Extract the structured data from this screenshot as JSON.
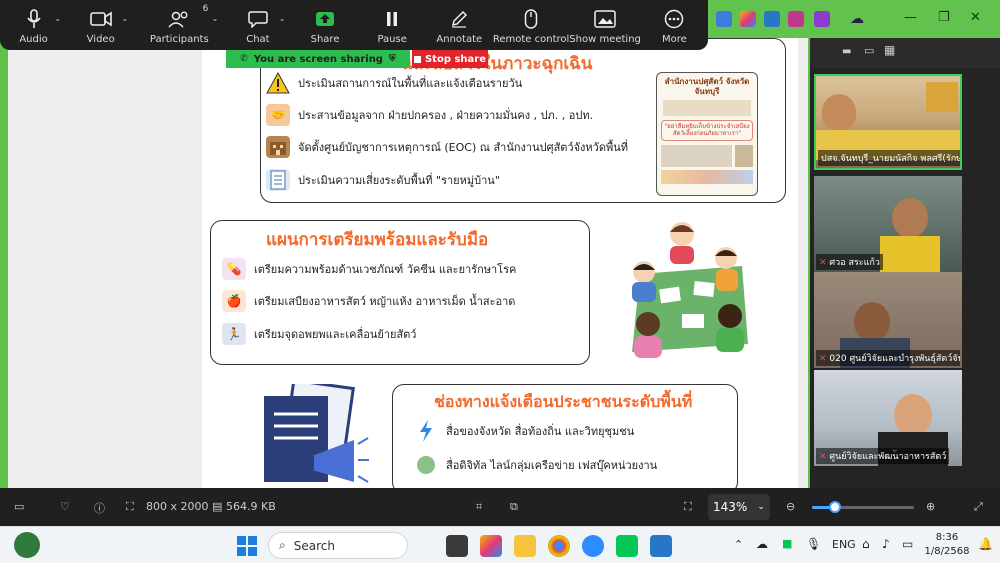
{
  "zoom_toolbar": {
    "audio": "Audio",
    "video": "Video",
    "participants": "Participants",
    "participants_count": "6",
    "chat": "Chat",
    "share": "Share",
    "pause": "Pause",
    "annotate": "Annotate",
    "remote_control": "Remote control",
    "show_meeting": "Show meeting",
    "more": "More"
  },
  "share_banner": {
    "status": "You are screen sharing",
    "stop": "Stop share"
  },
  "slide": {
    "section1": {
      "heading": "และสื่อสารในภาวะฉุกเฉิน",
      "items": [
        "ประเมินสถานการณ์ในพื้นที่และแจ้งเตือนรายวัน",
        "ประสานข้อมูลจาก ฝ่ายปกครอง , ฝ่ายความมั่นคง , ปภ. , อปท.",
        "จัดตั้งศูนย์บัญชาการเหตุการณ์ (EOC) ณ สำนักงานปศุสัตว์จังหวัดพื้นที่",
        "ประเมินความเสี่ยงระดับพื้นที่ \"รายหมู่บ้าน\""
      ],
      "poster_title": "สำนักงานปศุสัตว์ จังหวัดจันทบุรี",
      "poster_quote": "\"อย่าลืมหยิบเก็บข้างประจำเสบียงสัตว์เลี้ยงก่อนภัยมาหาเรา\""
    },
    "section2": {
      "heading": "แผนการเตรียมพร้อมและรับมือ",
      "items": [
        "เตรียมความพร้อมด้านเวชภัณฑ์ วัคซีน และยารักษาโรค",
        "เตรียมเสบียงอาหารสัตว์ หญ้าแห้ง อาหารเม็ด น้ำสะอาด",
        "เตรียมจุดอพยพและเคลื่อนย้ายสัตว์"
      ]
    },
    "section3": {
      "heading": "ช่องทางแจ้งเตือนประชาชนระดับพื้นที่",
      "items": [
        "สื่อของจังหวัด สื่อท้องถิ่น และวิทยุชุมชน",
        "สื่อดิจิทัล ไลน์กลุ่มเครือข่าย เฟสบุ๊คหน่วยงาน"
      ]
    }
  },
  "participants": [
    {
      "name": "ปสจ.จันทบุรี_นายมนัสกิจ พลศรี(รักษาการ)",
      "muted": false
    },
    {
      "name": "ศวอ สระแก้ว",
      "muted": true
    },
    {
      "name": "020 ศูนย์วิจัยและบำรุงพันธุ์สัตว์จันทบุรี",
      "muted": true
    },
    {
      "name": "ศูนย์วิจัยและพัฒนาอาหารสัตว์",
      "muted": true
    }
  ],
  "viewer_bar": {
    "dimensions": "800 x 2000",
    "file_size": "564.9 KB",
    "zoom": "143%"
  },
  "taskbar": {
    "search_placeholder": "Search",
    "language": "ENG",
    "time": "8:36",
    "date": "1/8/2568"
  },
  "colors": {
    "heading_orange": "#f26a2c",
    "share_green": "#2dbd4e",
    "stop_red": "#e0242b",
    "active_speaker_border": "#3ecf5a"
  }
}
